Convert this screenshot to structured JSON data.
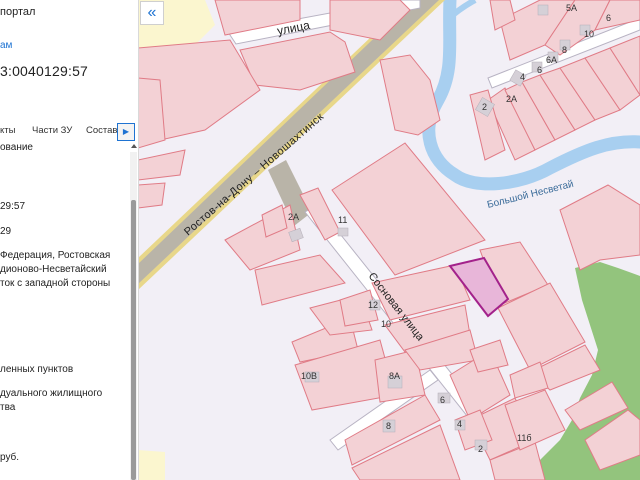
{
  "panel": {
    "portal_title": "портал",
    "link_text": "ам",
    "cadastral_number": "3:0040129:57",
    "tabs": [
      "кты",
      "Части ЗУ",
      "Состав"
    ],
    "tab_scroll_icon": "chevron-right-icon",
    "lines": [
      "ование",
      "29:57",
      "29",
      "Федерация, Ростовская",
      "дионово-Несветайский",
      "ток с западной стороны",
      "ленных пунктов",
      "дуального жилищного",
      "тва",
      "руб."
    ]
  },
  "map": {
    "collapse_icon": "double-chevron-left-icon",
    "labels": {
      "road_main": "Ростов-на-Дону – Новошахтинск",
      "street_top": "улица",
      "street_sosnovaya": "Сосновая улица",
      "river": "Большой Несветай",
      "h_2a": "2А",
      "h_11": "11",
      "h_12": "12",
      "h_10": "10",
      "h_10v": "10В",
      "h_8a": "8А",
      "h_6": "6",
      "h_4": "4",
      "h_8": "8",
      "h_2": "2",
      "h_11b": "11б",
      "t_5a": "5А",
      "t_6": "6",
      "t_10": "10",
      "t_8": "8",
      "t_6a": "6А",
      "t_4": "4",
      "t_2": "2",
      "t_2a": "2А"
    },
    "colors": {
      "background": "#f2eff6",
      "parcel_fill": "#f3d1d5",
      "parcel_stroke": "#e07b86",
      "selected_fill": "#e8b6d9",
      "selected_stroke": "#a3228b",
      "road": "#b9b4a8",
      "road_edge": "#e8d78a",
      "river": "#a8cff0",
      "forest": "#93c47d",
      "field": "#fbf6cf"
    }
  }
}
